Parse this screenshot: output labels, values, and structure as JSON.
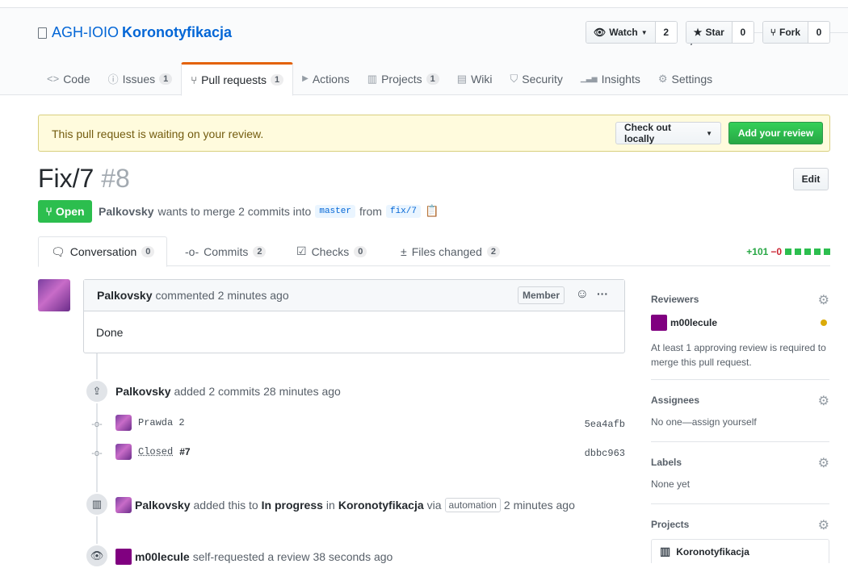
{
  "repo": {
    "owner": "AGH-IOIO",
    "separator": "/",
    "name": "Koronotyfikacja"
  },
  "actions": [
    {
      "label": "Watch",
      "icon": "eye-icon",
      "count": "2"
    },
    {
      "label": "Star",
      "icon": "star-icon",
      "count": "0"
    },
    {
      "label": "Fork",
      "icon": "fork-icon",
      "count": "0"
    }
  ],
  "tabs": [
    {
      "label": "Code",
      "icon": "code-icon",
      "glyph": "<>",
      "count": ""
    },
    {
      "label": "Issues",
      "icon": "issue-icon",
      "glyph": "ⓘ",
      "count": "1"
    },
    {
      "label": "Pull requests",
      "icon": "pull-request-icon",
      "glyph": "⑂",
      "count": "1"
    },
    {
      "label": "Actions",
      "icon": "play-icon",
      "glyph": "▶",
      "count": ""
    },
    {
      "label": "Projects",
      "icon": "project-icon",
      "glyph": "▥",
      "count": "1"
    },
    {
      "label": "Wiki",
      "icon": "book-icon",
      "glyph": "▤",
      "count": ""
    },
    {
      "label": "Security",
      "icon": "shield-icon",
      "glyph": "⛉",
      "count": ""
    },
    {
      "label": "Insights",
      "icon": "graph-icon",
      "glyph": "▁▃▅",
      "count": ""
    },
    {
      "label": "Settings",
      "icon": "gear-icon",
      "glyph": "⚙",
      "count": ""
    }
  ],
  "flash": {
    "message": "This pull request is waiting on your review.",
    "checkout": "Check out locally",
    "review": "Add your review"
  },
  "pr": {
    "title": "Fix/7",
    "number": "#8",
    "edit": "Edit",
    "state": "Open",
    "author": "Palkovsky",
    "merge_text": "wants to merge 2 commits into",
    "base": "master",
    "from": "from",
    "head": "fix/7"
  },
  "pr_tabs": [
    {
      "label": "Conversation",
      "count": "0"
    },
    {
      "label": "Commits",
      "count": "2"
    },
    {
      "label": "Checks",
      "count": "0"
    },
    {
      "label": "Files changed",
      "count": "2"
    }
  ],
  "diffstat": {
    "additions": "+101",
    "deletions": "−0"
  },
  "comment": {
    "author": "Palkovsky",
    "action": "commented",
    "time": "2 minutes ago",
    "role": "Member",
    "body": "Done"
  },
  "commits_event": {
    "author": "Palkovsky",
    "text": "added 2 commits",
    "time": "28 minutes ago"
  },
  "commits": [
    {
      "message": "Prawda 2",
      "ref": "",
      "sha": "5ea4afb"
    },
    {
      "message": "Closed",
      "ref": "#7",
      "sha": "dbbc963"
    }
  ],
  "project_event": {
    "author": "Palkovsky",
    "text1": "added this to",
    "column": "In progress",
    "text2": "in",
    "project": "Koronotyfikacja",
    "via": "via",
    "tag": "automation",
    "time": "2 minutes ago"
  },
  "review_event": {
    "author": "m00lecule",
    "text": "self-requested a review",
    "time": "38 seconds ago"
  },
  "sidebar": {
    "reviewers": {
      "heading": "Reviewers",
      "name": "m00lecule",
      "note": "At least 1 approving review is required to merge this pull request."
    },
    "assignees": {
      "heading": "Assignees",
      "value": "No one—assign yourself"
    },
    "labels": {
      "heading": "Labels",
      "value": "None yet"
    },
    "projects": {
      "heading": "Projects",
      "value": "Koronotyfikacja"
    }
  },
  "colors": {
    "accent": "#0366d6",
    "open": "#2cbe4e",
    "tab_underline": "#e36209",
    "pending": "#dbab09"
  }
}
